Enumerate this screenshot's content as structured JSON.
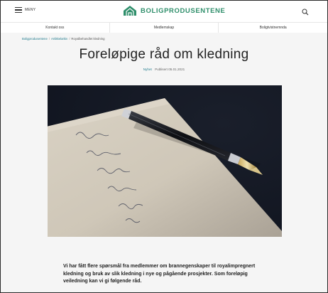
{
  "header": {
    "menu_label": "MENY",
    "brand_name": "BOLIGPRODUSENTENE",
    "brand_color": "#2f8f6b",
    "icons": {
      "menu": "hamburger-icon",
      "logo": "house-logo-icon",
      "search": "search-icon"
    }
  },
  "nav": {
    "items": [
      {
        "label": "Kontakt oss"
      },
      {
        "label": "Medlemskap"
      },
      {
        "label": "Boligtvistnemnda"
      }
    ]
  },
  "breadcrumb": {
    "items": [
      "Boligprodusentene",
      "Artikkelarkiv",
      "Royalbehandlet kledning"
    ]
  },
  "article": {
    "title": "Foreløpige råd om kledning",
    "tag": "Nyhet",
    "published": "Publisert 05.01.2021",
    "intro": "Vi har fått flere spørsmål fra medlemmer om brannegenskaper til royalimpregnert kledning og bruk av slik kledning i nye og pågående prosjekter. Som foreløpig veiledning kan vi gi følgende råd."
  }
}
